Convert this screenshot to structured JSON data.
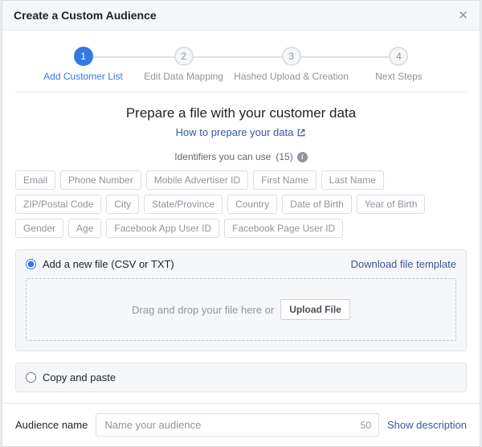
{
  "header": {
    "title": "Create a Custom Audience"
  },
  "steps": {
    "items": [
      {
        "num": "1",
        "label": "Add Customer List",
        "active": true
      },
      {
        "num": "2",
        "label": "Edit Data Mapping",
        "active": false
      },
      {
        "num": "3",
        "label": "Hashed Upload & Creation",
        "active": false
      },
      {
        "num": "4",
        "label": "Next Steps",
        "active": false
      }
    ]
  },
  "main": {
    "heading": "Prepare a file with your customer data",
    "help_link": "How to prepare your data",
    "identifiers_label": "Identifiers you can use",
    "identifiers_count": "(15)",
    "identifiers": [
      "Email",
      "Phone Number",
      "Mobile Advertiser ID",
      "First Name",
      "Last Name",
      "ZIP/Postal Code",
      "City",
      "State/Province",
      "Country",
      "Date of Birth",
      "Year of Birth",
      "Gender",
      "Age",
      "Facebook App User ID",
      "Facebook Page User ID"
    ]
  },
  "options": {
    "new_file_label": "Add a new file (CSV or TXT)",
    "download_template": "Download file template",
    "drop_text": "Drag and drop your file here or",
    "upload_button": "Upload File",
    "copy_paste_label": "Copy and paste"
  },
  "footer": {
    "audience_label": "Audience name",
    "audience_placeholder": "Name your audience",
    "char_limit": "50",
    "show_description": "Show description"
  }
}
